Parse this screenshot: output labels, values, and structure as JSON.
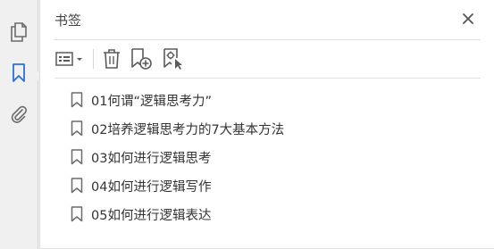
{
  "panel": {
    "title": "书签"
  },
  "left_rail": {
    "items": [
      {
        "icon": "pages-icon"
      },
      {
        "icon": "bookmark-icon",
        "active": true
      },
      {
        "icon": "paperclip-icon"
      }
    ]
  },
  "toolbar": {
    "buttons": [
      {
        "icon": "options-menu-icon"
      },
      {
        "icon": "trash-icon"
      },
      {
        "icon": "new-bookmark-icon"
      },
      {
        "icon": "new-bookmark-from-structure-icon"
      }
    ]
  },
  "bookmarks": [
    {
      "label": "01何谓“逻辑思考力”"
    },
    {
      "label": "02培养逻辑思考力的7大基本方法"
    },
    {
      "label": "03如何进行逻辑思考"
    },
    {
      "label": "04如何进行逻辑写作"
    },
    {
      "label": "05如何进行逻辑表达"
    }
  ],
  "colors": {
    "accent": "#2a6fdb",
    "icon_gray": "#6b6b6b"
  }
}
